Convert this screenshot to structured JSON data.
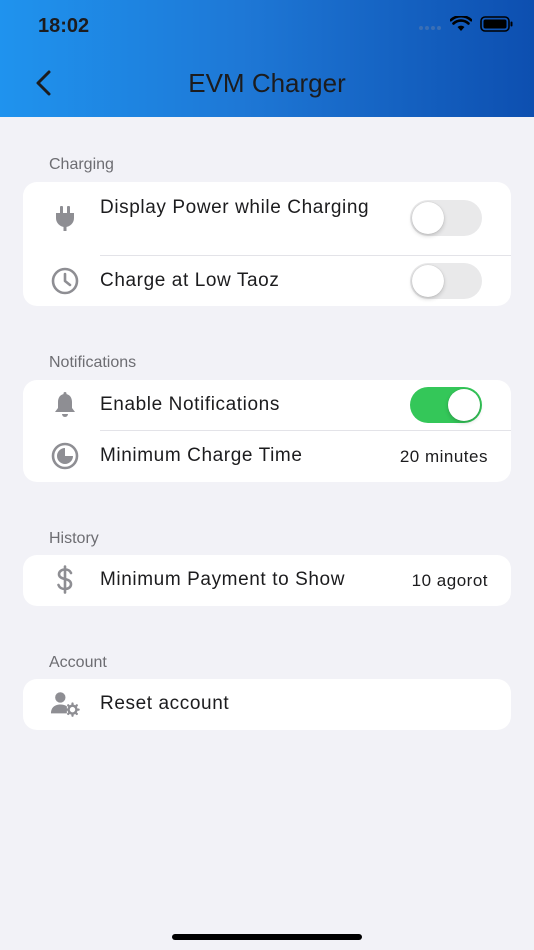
{
  "status_bar": {
    "time": "18:02",
    "icons": [
      "cellular-signal-icon",
      "wifi-icon",
      "battery-icon"
    ]
  },
  "nav": {
    "title": "EVM Charger",
    "back_icon": "chevron-left-icon"
  },
  "colors": {
    "header_gradient_start": "#1f93ee",
    "header_gradient_end": "#0d4fb0",
    "toggle_on": "#34c759",
    "toggle_off": "#e9e9ea",
    "icon_gray": "#8e8e93",
    "background": "#f2f2f7"
  },
  "sections": {
    "charging": {
      "label": "Charging",
      "rows": [
        {
          "label": "Display Power while Charging",
          "icon": "plug-icon",
          "toggle": false
        },
        {
          "label": "Charge at Low Taoz",
          "icon": "clock-icon",
          "toggle": false
        }
      ]
    },
    "notifications": {
      "label": "Notifications",
      "rows": [
        {
          "label": "Enable Notifications",
          "icon": "bell-icon",
          "toggle": true
        },
        {
          "label": "Minimum Charge Time",
          "icon": "timer-icon",
          "value": "20 minutes"
        }
      ]
    },
    "history": {
      "label": "History",
      "rows": [
        {
          "label": "Minimum Payment to Show",
          "icon": "dollar-icon",
          "value": "10 agorot"
        }
      ]
    },
    "account": {
      "label": "Account",
      "rows": [
        {
          "label": "Reset account",
          "icon": "user-gear-icon"
        }
      ]
    }
  }
}
